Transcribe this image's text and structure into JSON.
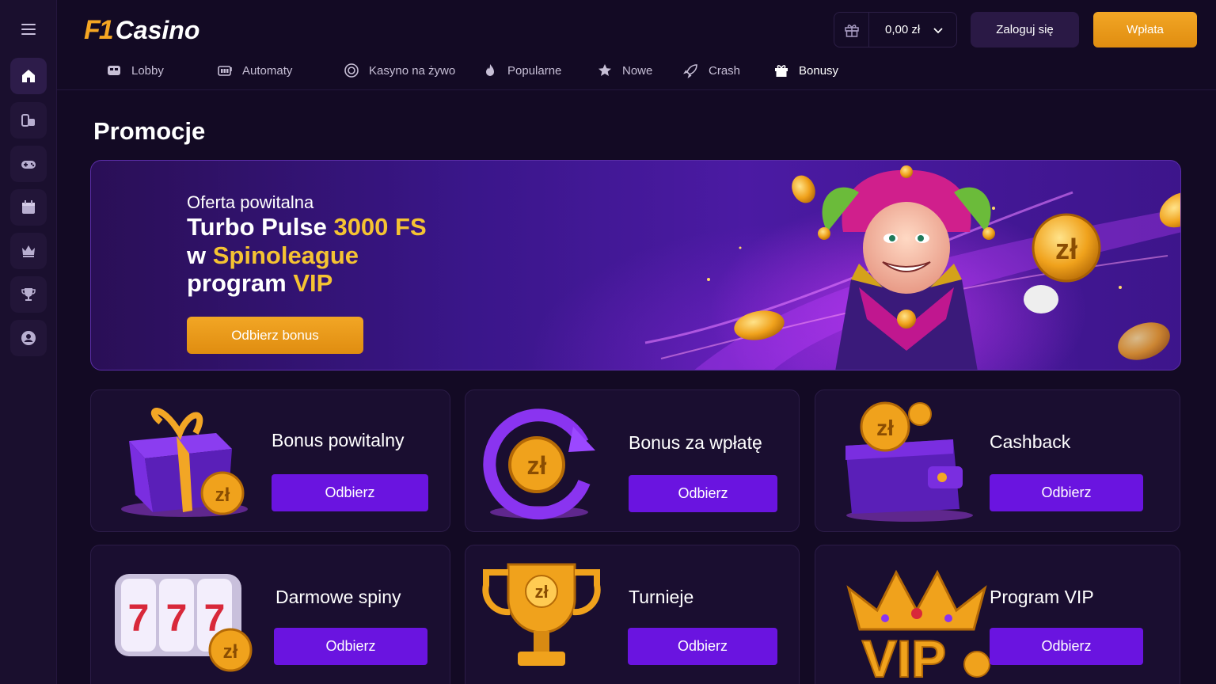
{
  "brand": {
    "logo_mark": "F1",
    "logo_text": "Casino",
    "accent": "#f5a623",
    "purple": "#6a14e0"
  },
  "sidebar": {
    "items": [
      {
        "icon": "home-icon"
      },
      {
        "icon": "slots-icon"
      },
      {
        "icon": "gamepad-icon"
      },
      {
        "icon": "calendar-icon"
      },
      {
        "icon": "crown-icon"
      },
      {
        "icon": "trophy-icon"
      },
      {
        "icon": "user-icon"
      }
    ]
  },
  "header": {
    "balance": "0,00 zł",
    "login_label": "Zaloguj się",
    "deposit_label": "Wpłata"
  },
  "nav": [
    {
      "label": "Lobby",
      "icon": "lobby-icon"
    },
    {
      "label": "Automaty",
      "icon": "slot-machine-icon"
    },
    {
      "label": "Kasyno na żywo",
      "icon": "live-casino-icon"
    },
    {
      "label": "Popularne",
      "icon": "flame-icon"
    },
    {
      "label": "Nowe",
      "icon": "star-icon"
    },
    {
      "label": "Crash",
      "icon": "rocket-icon"
    },
    {
      "label": "Bonusy",
      "icon": "gift-icon",
      "active": true
    }
  ],
  "main": {
    "title": "Promocje",
    "hero": {
      "kicker": "Oferta powitalna",
      "line1_a": "Turbo Pulse ",
      "line1_b": "3000 FS",
      "line2_a": "w ",
      "line2_b": "Spinoleague",
      "line3_a": "program ",
      "line3_b": "VIP",
      "cta": "Odbierz bonus"
    },
    "cards": [
      {
        "title": "Bonus powitalny",
        "button": "Odbierz",
        "art": "gift-box"
      },
      {
        "title": "Bonus za wpłatę",
        "button": "Odbierz",
        "art": "coin-arrow"
      },
      {
        "title": "Cashback",
        "button": "Odbierz",
        "art": "wallet"
      },
      {
        "title": "Darmowe spiny",
        "button": "Odbierz",
        "art": "slot-777"
      },
      {
        "title": "Turnieje",
        "button": "Odbierz",
        "art": "trophy"
      },
      {
        "title": "Program VIP",
        "button": "Odbierz",
        "art": "vip-crown"
      }
    ],
    "coin_symbol": "zł",
    "reels_text": "777",
    "vip_text": "VIP"
  }
}
